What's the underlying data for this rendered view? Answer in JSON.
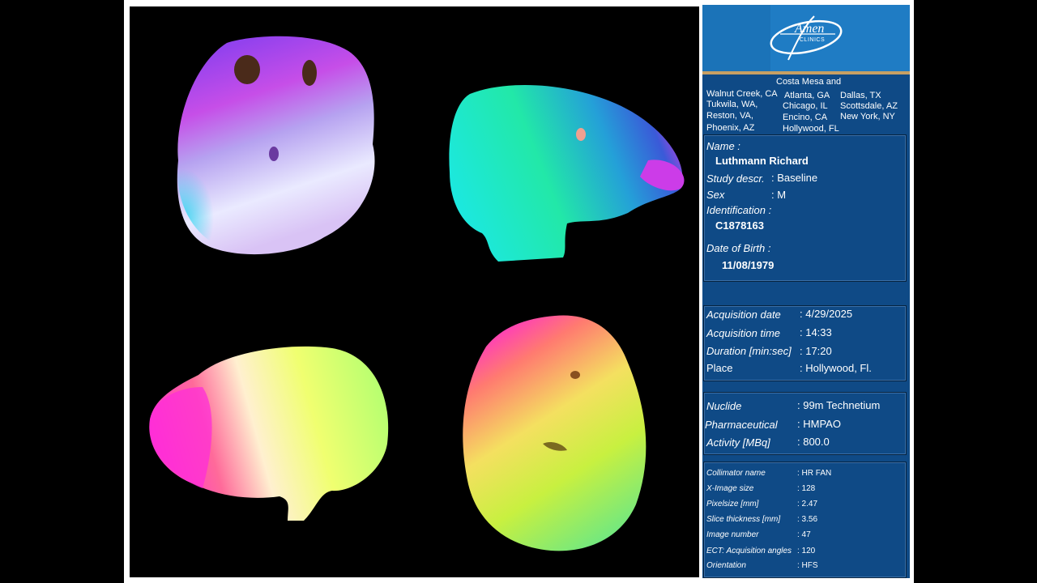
{
  "logo": {
    "brand": "Amen",
    "sub": "CLINICS"
  },
  "locations": {
    "header": "Costa Mesa and",
    "items": [
      "Walnut Creek, CA",
      "Atlanta, GA",
      "Dallas, TX",
      "Tukwila, WA,",
      "Chicago, IL",
      "Scottsdale, AZ",
      "Reston, VA,",
      "Encino, CA",
      "New York, NY",
      "Phoenix, AZ",
      "Hollywood, FL"
    ]
  },
  "patient": {
    "name_label": "Name :",
    "name": "Luthmann Richard",
    "study_label": "Study descr.",
    "study_value": ": Baseline",
    "sex_label": "Sex",
    "sex_value": ": M",
    "id_label": "Identification :",
    "id_value": "C1878163",
    "dob_label": "Date of Birth :",
    "dob_value": "11/08/1979"
  },
  "acquisition": {
    "date_label": "Acquisition date",
    "date_value": ":    4/29/2025",
    "time_label": "Acquisition time",
    "time_value": ": 14:33",
    "duration_label": "Duration [min:sec]",
    "duration_value": ": 17:20",
    "place_label": "Place",
    "place_value": ": Hollywood, Fl."
  },
  "nuclide": {
    "nuclide_label": "Nuclide",
    "nuclide_value": ":  99m Technetium",
    "pharma_label": "Pharmaceutical",
    "pharma_value": ": HMPAO",
    "activity_label": "Activity [MBq]",
    "activity_value": ": 800.0"
  },
  "tech": {
    "collimator_label": "Collimator name",
    "collimator_value": ": HR FAN",
    "ximage_label": "X-Image size",
    "ximage_value": ": 128",
    "pixel_label": "Pixelsize [mm]",
    "pixel_value": ": 2.47",
    "slice_label": "Slice thickness [mm]",
    "slice_value": ": 3.56",
    "imgnum_label": "Image number",
    "imgnum_value": ":  47",
    "angles_label": "ECT: Acquisition angles",
    "angles_value": ": 120",
    "orient_label": "Orientation",
    "orient_value": ": HFS"
  },
  "colors": {
    "panel": "#0f4a86",
    "logo_bg": "#1f7cc4",
    "accent": "#c7a064"
  }
}
